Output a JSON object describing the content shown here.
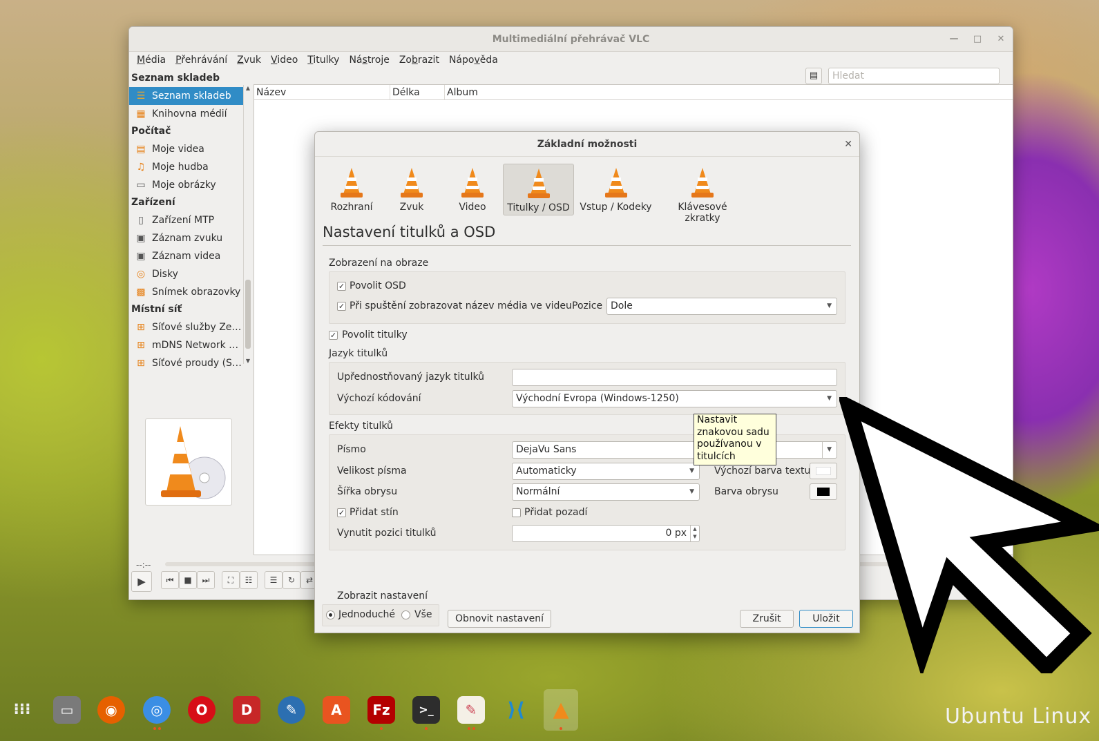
{
  "vlc": {
    "title": "Multimediální přehrávač VLC",
    "menus": [
      {
        "pre": "",
        "ul": "M",
        "post": "édia"
      },
      {
        "pre": "",
        "ul": "P",
        "post": "řehrávání"
      },
      {
        "pre": "",
        "ul": "Z",
        "post": "vuk"
      },
      {
        "pre": "",
        "ul": "V",
        "post": "ideo"
      },
      {
        "pre": "",
        "ul": "T",
        "post": "itulky"
      },
      {
        "pre": "Ná",
        "ul": "s",
        "post": "troje"
      },
      {
        "pre": "Zo",
        "ul": "b",
        "post": "razit"
      },
      {
        "pre": "Nápo",
        "ul": "v",
        "post": "ěda"
      }
    ],
    "sidebar_header": "Seznam skladeb",
    "sections": {
      "playlist_item": "Seznam skladeb",
      "library": "Knihovna médií",
      "computer": "Počítač",
      "my_videos": "Moje videa",
      "my_music": "Moje hudba",
      "my_pictures": "Moje obrázky",
      "devices": "Zařízení",
      "mtp": "Zařízení MTP",
      "audio_capture": "Záznam zvuku",
      "video_capture": "Záznam videa",
      "discs": "Disky",
      "screen": "Snímek obrazovky",
      "local_network": "Místní síť",
      "net_services": "Síťové služby Ze…",
      "mdns": "mDNS Network …",
      "net_streams": "Síťové proudy (S…"
    },
    "search_placeholder": "Hledat",
    "columns": {
      "name": "Název",
      "length": "Délka",
      "album": "Album"
    },
    "time": "--:--"
  },
  "dialog": {
    "title": "Základní možnosti",
    "categories": [
      "Rozhraní",
      "Zvuk",
      "Video",
      "Titulky / OSD",
      "Vstup / Kodeky",
      "Klávesové zkratky"
    ],
    "section_title": "Nastavení titulků a OSD",
    "osd_group": "Zobrazení na obraze",
    "enable_osd": "Povolit OSD",
    "show_media_title": "Při spuštění zobrazovat název média ve videu",
    "position_label": "Pozice",
    "position_value": "Dole",
    "enable_subtitles": "Povolit titulky",
    "lang_group": "Jazyk titulků",
    "preferred_lang": "Upřednostňovaný jazyk titulků",
    "preferred_lang_value": "",
    "default_encoding": "Výchozí kódování",
    "encoding_value": "Východní Evropa (Windows-1250)",
    "effects_group": "Efekty titulků",
    "font_label": "Písmo",
    "font_value": "DejaVu Sans",
    "font_size_label": "Velikost písma",
    "font_size_value": "Automaticky",
    "text_color_label": "Výchozí barva textu",
    "outline_width_label": "Šířka obrysu",
    "outline_width_value": "Normální",
    "outline_color_label": "Barva obrysu",
    "add_shadow": "Přidat stín",
    "add_background": "Přidat pozadí",
    "force_position_label": "Vynutit pozici titulků",
    "force_position_value": "0 px",
    "show_settings": "Zobrazit nastavení",
    "simple": "Jednoduché",
    "all": "Vše",
    "reset": "Obnovit nastavení",
    "cancel": "Zrušit",
    "save": "Uložit",
    "tooltip": "Nastavit znakovou sadu používanou v titulcích"
  },
  "desktop": {
    "brand": "Ubuntu Linux"
  },
  "colors": {
    "selection": "#308cc6",
    "vlc_orange": "#f08a1c",
    "tooltip_bg": "#ffffdc"
  }
}
